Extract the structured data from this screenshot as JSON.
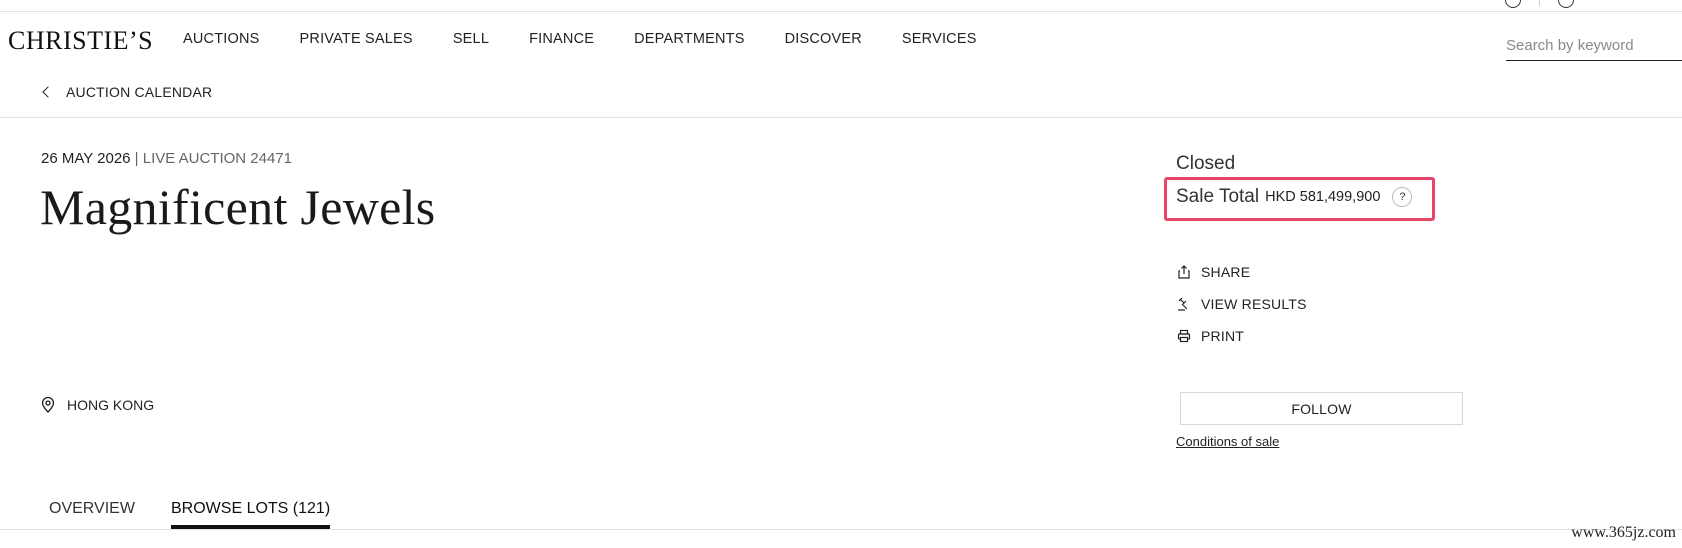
{
  "header": {
    "logo": "CHRISTIE’S",
    "nav": [
      "AUCTIONS",
      "PRIVATE SALES",
      "SELL",
      "FINANCE",
      "DEPARTMENTS",
      "DISCOVER",
      "SERVICES"
    ],
    "search_placeholder": "Search by keyword"
  },
  "breadcrumb": {
    "back_label": "AUCTION CALENDAR"
  },
  "auction": {
    "date": "26 MAY 2026",
    "separator": " | ",
    "type": "LIVE AUCTION 24471",
    "title": "Magnificent Jewels",
    "location": "HONG KONG"
  },
  "sale": {
    "status": "Closed",
    "total_label": "Sale Total",
    "total_amount": "HKD 581,499,900",
    "help_symbol": "?"
  },
  "actions": {
    "share": "SHARE",
    "view_results": "VIEW RESULTS",
    "print": "PRINT",
    "follow": "FOLLOW",
    "conditions": "Conditions of sale"
  },
  "tabs": {
    "overview": "OVERVIEW",
    "browse_lots": "BROWSE LOTS (121)"
  },
  "watermark": "www.365jz.com",
  "colors": {
    "highlight_border": "#e8476a",
    "text": "#1a1a1a",
    "divider": "#e3e3e3"
  }
}
